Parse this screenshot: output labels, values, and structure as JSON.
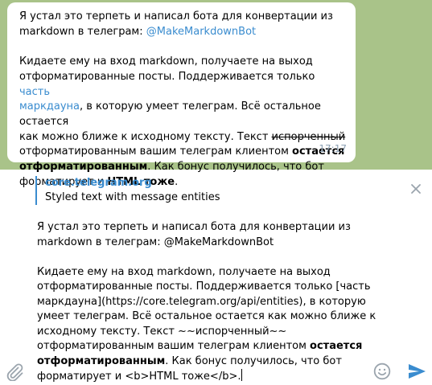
{
  "message": {
    "line1": "Я устал это терпеть и написал бота для конвертации из",
    "line2_text": "markdown в телеграм: ",
    "line2_link": "@MakeMarkdownBot",
    "line3": "Кидаете ему на вход markdown, получаете на выход",
    "line4_text": "отформатированные посты. Поддерживается только ",
    "line4_link": "часть",
    "line5_link": "маркдауна",
    "line5_text": ", в которую умеет телеграм. Всё остальное остается",
    "line6_text": "как можно ближе к исходному тексту. Текст ",
    "line6_strike": "испорченный",
    "line7_text": "отформатированным вашим телеграм клиентом ",
    "line7_bold": "остается",
    "line8_bold": "отформатированным",
    "line8_text": ". Как бонус получилось, что бот",
    "line9_text": "форматирует и ",
    "line9_bold": "HTML тоже",
    "line9_end": ".",
    "time": "17:17"
  },
  "link_preview": {
    "title": "core.telegram.org",
    "description": "Styled text with message entities"
  },
  "input": {
    "line1": "Я устал это терпеть и написал бота для конвертации из",
    "line2": "markdown в телеграм: @MakeMarkdownBot",
    "line3": "Кидаете ему на вход markdown, получаете на выход",
    "line4": "отформатированные посты. Поддерживается только [часть",
    "line5": "маркдауна](https://core.telegram.org/api/entities), в которую",
    "line6": "умеет телеграм. Всё остальное остается как можно ближе к",
    "line7": "исходному тексту. Текст ~~испорченный~~",
    "line8_text": "отформатированным вашим телеграм клиентом ",
    "line8_bold": "остается",
    "line9_bold": "отформатированным",
    "line9_text": ". Как бонус получилось, что бот",
    "line10": "форматирует и <b>HTML тоже</b>."
  },
  "colors": {
    "chat_background": "#a9c389",
    "link": "#3a8ccf",
    "time": "#8ea2b5",
    "icon": "#9aa4ad",
    "send": "#3a8ccf"
  },
  "icons": {
    "close": "close-icon",
    "attach": "paperclip-icon",
    "emoji": "emoji-icon",
    "send": "send-icon"
  }
}
